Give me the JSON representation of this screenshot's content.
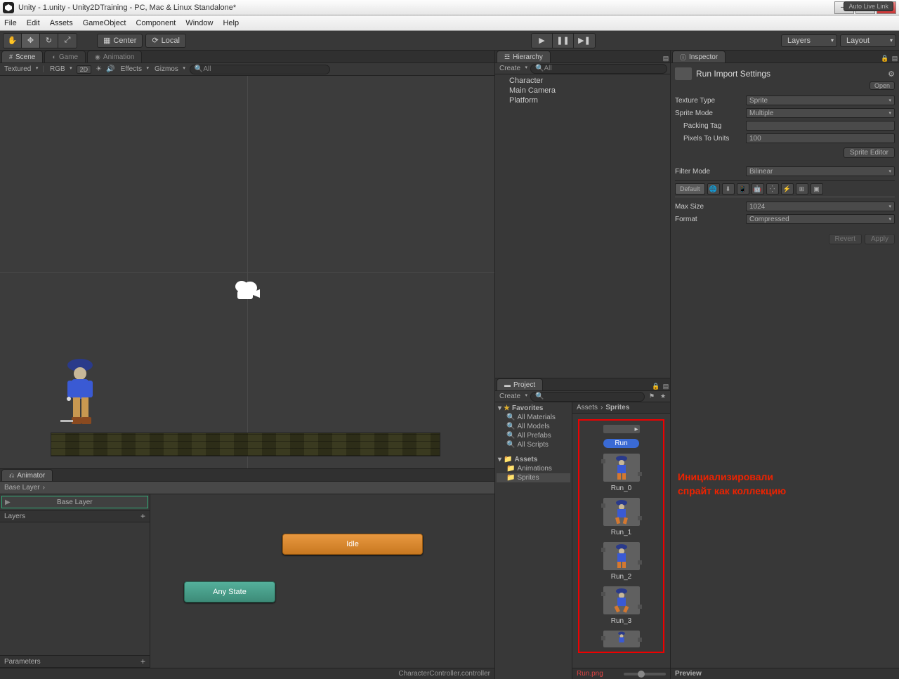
{
  "window": {
    "title": "Unity - 1.unity - Unity2DTraining - PC, Mac & Linux Standalone*"
  },
  "menu": {
    "file": "File",
    "edit": "Edit",
    "assets": "Assets",
    "gameObject": "GameObject",
    "component": "Component",
    "window": "Window",
    "help": "Help"
  },
  "toolbar": {
    "center": "Center",
    "local": "Local",
    "layers": "Layers",
    "layout": "Layout"
  },
  "tabs": {
    "scene": "Scene",
    "game": "Game",
    "animation": "Animation",
    "animator": "Animator",
    "hierarchy": "Hierarchy",
    "project": "Project",
    "inspector": "Inspector"
  },
  "sceneControls": {
    "textured": "Textured",
    "rgb": "RGB",
    "twoD": "2D",
    "effects": "Effects",
    "gizmos": "Gizmos",
    "searchPlaceholder": "All"
  },
  "hierarchy": {
    "create": "Create",
    "searchPlaceholder": "All",
    "items": [
      "Character",
      "Main Camera",
      "Platform"
    ]
  },
  "project": {
    "create": "Create",
    "searchPlaceholder": "",
    "favorites": "Favorites",
    "favItems": [
      "All Materials",
      "All Models",
      "All Prefabs",
      "All Scripts"
    ],
    "assets": "Assets",
    "folders": [
      "Animations",
      "Sprites"
    ],
    "breadcrumb": [
      "Assets",
      "Sprites"
    ],
    "runLabel": "Run",
    "sprites": [
      "Run_0",
      "Run_1",
      "Run_2",
      "Run_3"
    ],
    "footer": "Run.png"
  },
  "inspector": {
    "title": "Run Import Settings",
    "open": "Open",
    "textureType": {
      "label": "Texture Type",
      "value": "Sprite"
    },
    "spriteMode": {
      "label": "Sprite Mode",
      "value": "Multiple"
    },
    "packingTag": {
      "label": "Packing Tag",
      "value": ""
    },
    "pixelsToUnits": {
      "label": "Pixels To Units",
      "value": "100"
    },
    "spriteEditor": "Sprite Editor",
    "filterMode": {
      "label": "Filter Mode",
      "value": "Bilinear"
    },
    "defaultTab": "Default",
    "maxSize": {
      "label": "Max Size",
      "value": "1024"
    },
    "format": {
      "label": "Format",
      "value": "Compressed"
    },
    "revert": "Revert",
    "apply": "Apply",
    "preview": "Preview"
  },
  "animator": {
    "baseLayerBreadcrumb": "Base Layer",
    "baseLayer": "Base Layer",
    "layers": "Layers",
    "parameters": "Parameters",
    "autoLink": "Auto Live Link",
    "idle": "Idle",
    "anyState": "Any State",
    "footer": "CharacterController.controller"
  },
  "annotation": {
    "line1": "Инициализировали",
    "line2": "спрайт как коллекцию"
  }
}
